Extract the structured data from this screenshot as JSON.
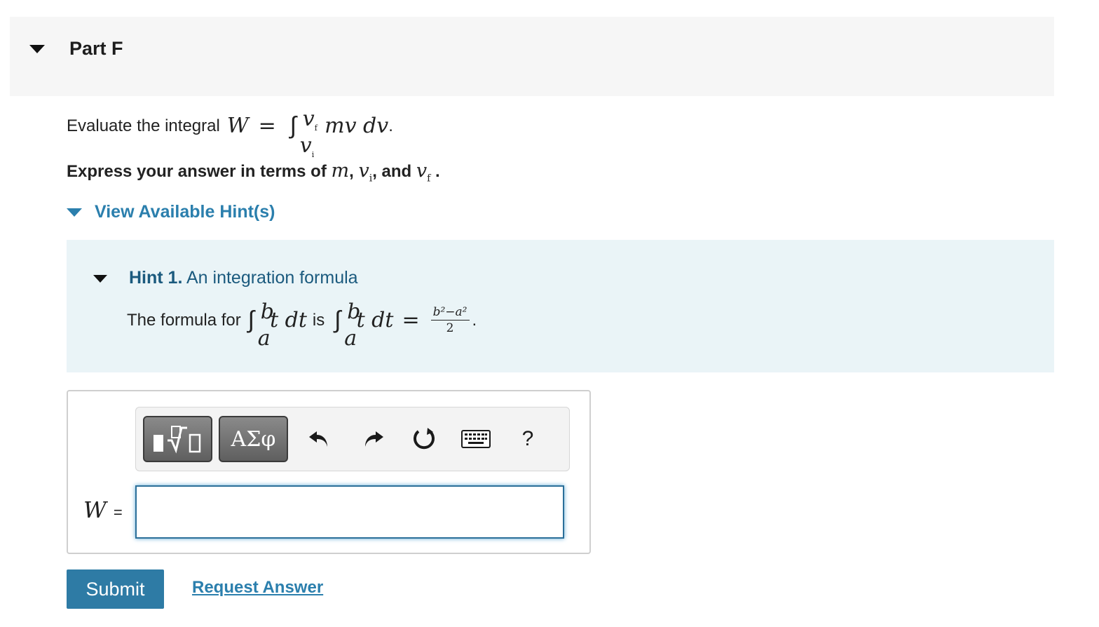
{
  "part": {
    "title": "Part F"
  },
  "question": {
    "prefix": "Evaluate the integral",
    "lhs": "W",
    "equals": "=",
    "upper_limit": "v",
    "upper_sub": "f",
    "lower_limit": "v",
    "lower_sub": "i",
    "integrand": "mv dv",
    "suffix": "."
  },
  "instruction": {
    "prefix": "Express your answer in terms of",
    "var1": "m",
    "comma1": ",",
    "var2": "v",
    "var2_sub": "i",
    "comma2": ", and",
    "var3": "v",
    "var3_sub": "f",
    "suffix": "."
  },
  "hints": {
    "toggle_label": "View Available Hint(s)",
    "hint1": {
      "number_label": "Hint 1.",
      "title": "An integration formula",
      "text_prefix": "The formula for",
      "int_upper": "b",
      "int_lower": "a",
      "integrand": "t dt",
      "text_mid": "is",
      "equals": "=",
      "frac_num": "b²−a²",
      "frac_den": "2",
      "suffix": "."
    }
  },
  "toolbar": {
    "templates_label": "▮√▯",
    "greek_label": "ΑΣφ",
    "undo_icon": "undo-icon",
    "redo_icon": "redo-icon",
    "reset_icon": "reset-icon",
    "keyboard_icon": "keyboard-icon",
    "help_label": "?"
  },
  "answer": {
    "label": "W",
    "equals": "=",
    "value": ""
  },
  "actions": {
    "submit_label": "Submit",
    "request_label": "Request Answer"
  }
}
